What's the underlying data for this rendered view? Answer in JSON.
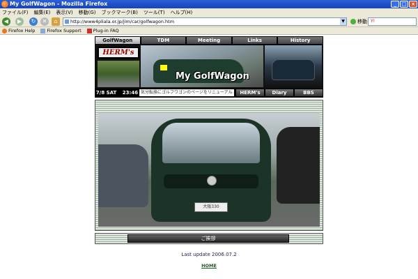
{
  "window": {
    "title": "My GolfWagon - Mozilla Firefox",
    "buttons": [
      "_",
      "□",
      "×"
    ]
  },
  "menu": [
    "ファイル(F)",
    "編集(E)",
    "表示(V)",
    "移動(G)",
    "ブックマーク(B)",
    "ツール(T)",
    "ヘルプ(H)"
  ],
  "nav": {
    "url": "http://www4pliala.or.jp/jim/car/golfwagon.htm",
    "go_label": "移動",
    "search_value": "Y!"
  },
  "bookmarks": [
    "Firefox Help",
    "Firefox Support",
    "Plug-in FAQ"
  ],
  "header": {
    "tabs": [
      "GolfWagon",
      "TDM",
      "Meeting",
      "Links",
      "History"
    ],
    "logo_text": "HERM's",
    "site_title": "My GolfWagon",
    "date": "7/8 SAT",
    "time": "23:46",
    "marquee": "気分転換にゴルフワゴンのページをリニューアル",
    "subtabs": [
      "HERM's",
      "Diary",
      "BBS"
    ]
  },
  "photo": {
    "plate_text": "大阪330"
  },
  "action_button": "ご挨拶",
  "footer": {
    "last_update": "Last update 2006.07.2",
    "home_link": "HOME"
  }
}
